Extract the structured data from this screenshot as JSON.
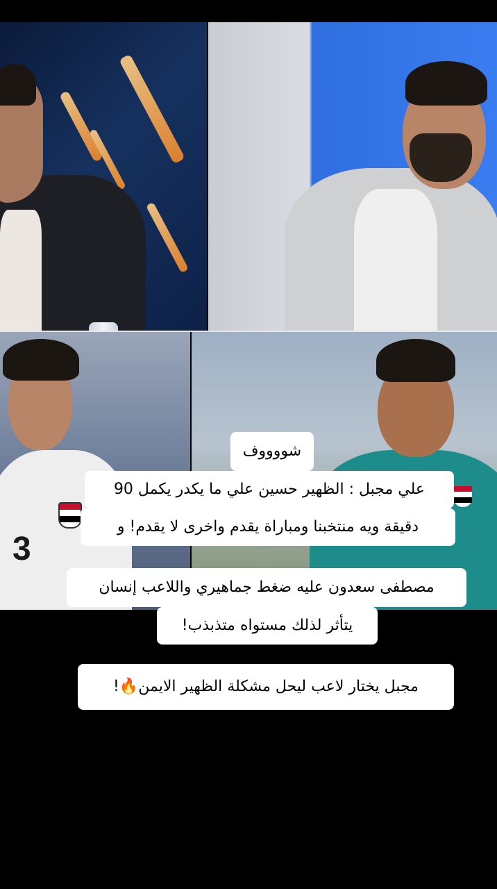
{
  "captions": {
    "title": "شووووف",
    "line1": "علي مجبل : الظهير حسين علي ما يكدر يكمل 90",
    "line2": "دقيقة ويه منتخبنا ومباراة يقدم واخرى لا يقدم! و",
    "line3": "مصطفى سعدون عليه ضغط جماهيري واللاعب إنسان",
    "line4": "يتأثر لذلك مستواه متذبذب!",
    "line5": "مجبل يختار لاعب ليحل مشكلة الظهير الايمن🔥!"
  },
  "jersey": {
    "number": "3"
  },
  "colors": {
    "studio_blue": "#3a7df0",
    "caption_bg": "#ffffff",
    "background": "#000000"
  }
}
